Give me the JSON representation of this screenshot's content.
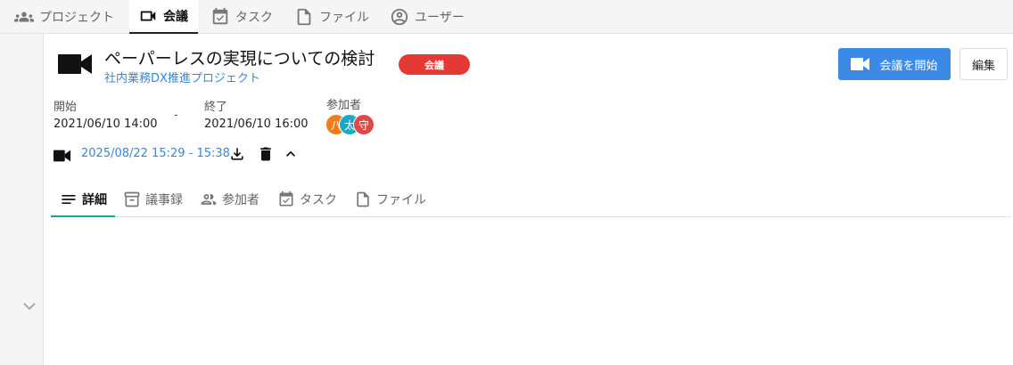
{
  "nav": {
    "tabs": [
      {
        "label": "プロジェクト",
        "icon": "people-icon"
      },
      {
        "label": "会議",
        "icon": "video-camera-icon"
      },
      {
        "label": "タスク",
        "icon": "calendar-check-icon"
      },
      {
        "label": "ファイル",
        "icon": "file-icon"
      },
      {
        "label": "ユーザー",
        "icon": "account-circle-icon"
      }
    ],
    "active_index": 1
  },
  "meeting": {
    "title": "ペーパーレスの実現についての検討",
    "project": "社内業務DX推進プロジェクト",
    "badge": "会議",
    "badge_color": "#e53935",
    "start_button": "会議を開始",
    "edit_button": "編集"
  },
  "schedule": {
    "start_label": "開始",
    "start_value": "2021/06/10 14:00",
    "separator": "-",
    "end_label": "終了",
    "end_value": "2021/06/10 16:00",
    "participants_label": "参加者",
    "participants": [
      {
        "initial": "八",
        "color": "#ef7d1a"
      },
      {
        "initial": "太",
        "color": "#17a9c6"
      },
      {
        "initial": "守",
        "color": "#e04848"
      }
    ]
  },
  "recording": {
    "text": "2025/08/22 15:29 - 15:38"
  },
  "detail_tabs": {
    "tabs": [
      {
        "label": "詳細",
        "icon": "notes-icon"
      },
      {
        "label": "議事録",
        "icon": "archive-icon"
      },
      {
        "label": "参加者",
        "icon": "people-outline-icon"
      },
      {
        "label": "タスク",
        "icon": "calendar-check-icon"
      },
      {
        "label": "ファイル",
        "icon": "file-icon"
      }
    ],
    "active_index": 0
  },
  "colors": {
    "accent": "#3b8ae6",
    "link": "#3a86d4",
    "active_tab_underline": "#1aa3a3"
  }
}
